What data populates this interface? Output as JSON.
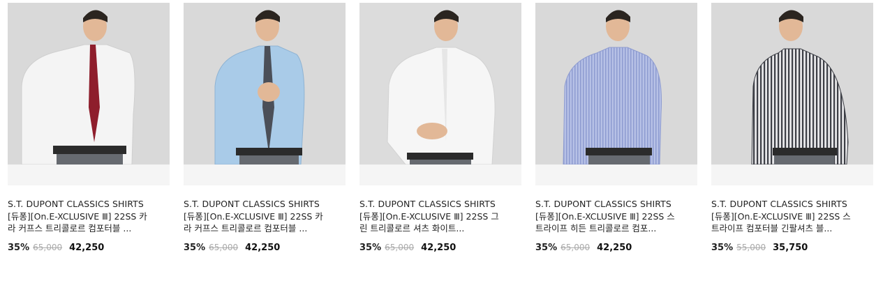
{
  "products": [
    {
      "brand": "S.T. DUPONT CLASSICS SHIRTS",
      "name_line1": "[듀퐁][On.E-XCLUSIVE Ⅲ] 22SS 카",
      "name_line2": "라 커프스 트리콜로르 컴포터블 ...",
      "discount": "35%",
      "original_price": "65,000",
      "final_price": "42,250",
      "image_label": "man in white shirt with burgundy tie",
      "shirt_color": "#f4f4f4",
      "tie_color": "#8e1e2c"
    },
    {
      "brand": "S.T. DUPONT CLASSICS SHIRTS",
      "name_line1": "[듀퐁][On.E-XCLUSIVE Ⅲ] 22SS 카",
      "name_line2": "라 커프스 트리콜로르 컴포터블 ...",
      "discount": "35%",
      "original_price": "65,000",
      "final_price": "42,250",
      "image_label": "man in light blue shirt with grey tie",
      "shirt_color": "#a9cbe8",
      "tie_color": "#4b4f58"
    },
    {
      "brand": "S.T. DUPONT CLASSICS SHIRTS",
      "name_line1": "[듀퐁][On.E-XCLUSIVE Ⅲ] 22SS 그",
      "name_line2": "린 트리콜로르 셔츠 화이트...",
      "discount": "35%",
      "original_price": "65,000",
      "final_price": "42,250",
      "image_label": "man in white shirt",
      "shirt_color": "#f6f6f6",
      "tie_color": ""
    },
    {
      "brand": "S.T. DUPONT CLASSICS SHIRTS",
      "name_line1": "[듀퐁][On.E-XCLUSIVE Ⅲ] 22SS 스",
      "name_line2": "트라이프 히든 트리콜로르 컴포...",
      "discount": "35%",
      "original_price": "65,000",
      "final_price": "42,250",
      "image_label": "man in blue striped shirt",
      "shirt_color": "#a7b3dc",
      "tie_color": ""
    },
    {
      "brand": "S.T. DUPONT CLASSICS SHIRTS",
      "name_line1": "[듀퐁][On.E-XCLUSIVE Ⅲ] 22SS 스",
      "name_line2": "트라이프 컴포터블 긴팔셔츠 블...",
      "discount": "35%",
      "original_price": "55,000",
      "final_price": "35,750",
      "image_label": "man in black and white striped shirt",
      "shirt_color": "#7d7f85",
      "tie_color": ""
    }
  ]
}
